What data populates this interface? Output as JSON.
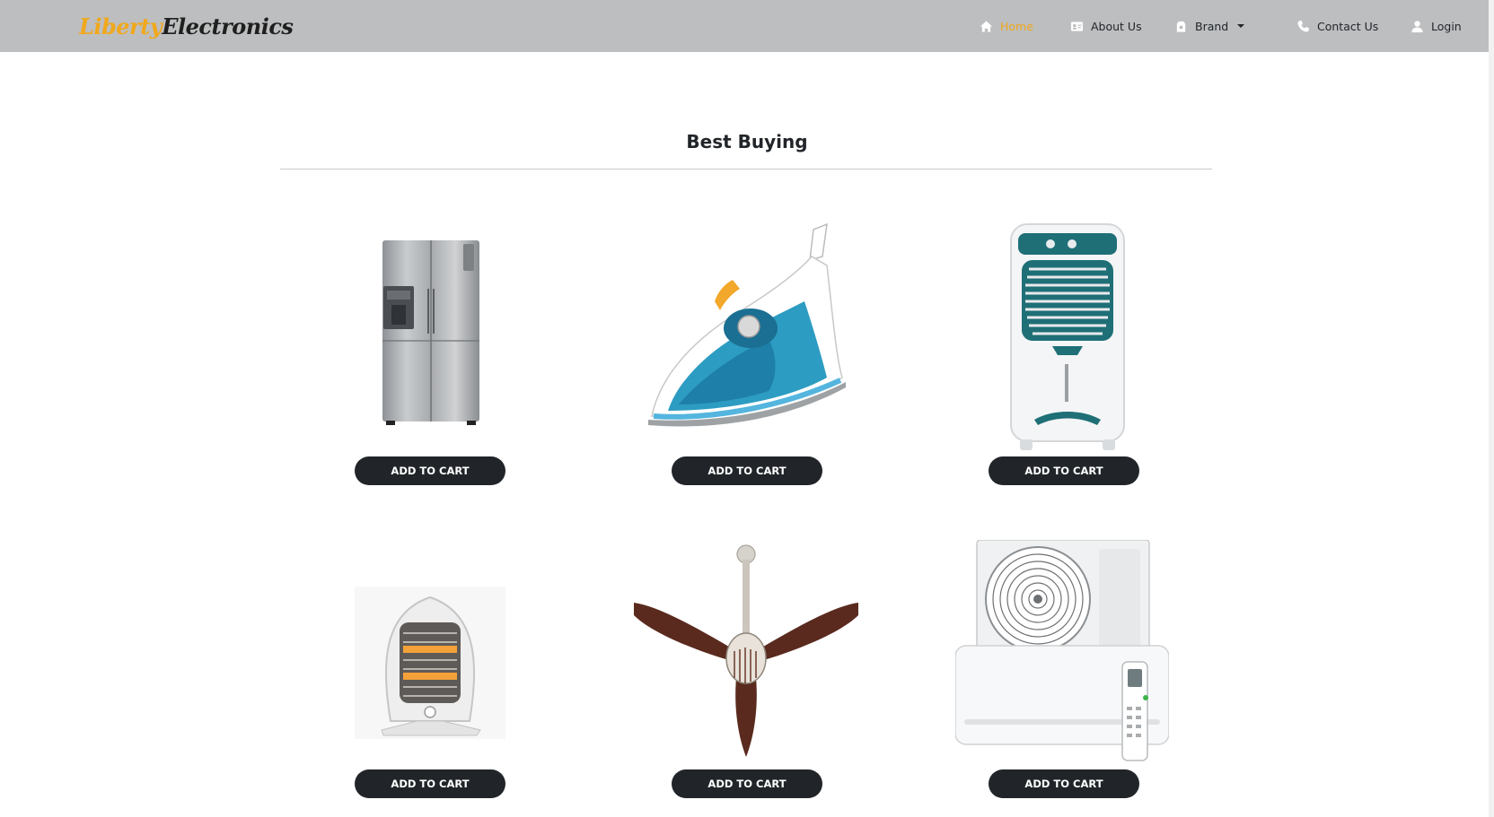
{
  "navbar": {
    "brand_part1": "Liberty",
    "brand_part2": "Electronics",
    "items": [
      {
        "label": "Home",
        "icon": "home-icon",
        "active": true
      },
      {
        "label": "About Us",
        "icon": "id-card-icon",
        "active": false
      },
      {
        "label": "Brand",
        "icon": "tag-icon",
        "active": false,
        "dropdown": true
      },
      {
        "label": "Contact Us",
        "icon": "phone-icon",
        "active": false
      },
      {
        "label": "Login",
        "icon": "user-icon",
        "active": false
      }
    ]
  },
  "section": {
    "title": "Best Buying"
  },
  "products": [
    {
      "image": "refrigerator-image",
      "button_label": "ADD TO CART"
    },
    {
      "image": "steam-iron-image",
      "button_label": "ADD TO CART"
    },
    {
      "image": "air-cooler-image",
      "button_label": "ADD TO CART"
    },
    {
      "image": "room-heater-image",
      "button_label": "ADD TO CART"
    },
    {
      "image": "ceiling-fan-image",
      "button_label": "ADD TO CART"
    },
    {
      "image": "air-conditioner-image",
      "button_label": "ADD TO CART"
    }
  ],
  "colors": {
    "navbar_bg": "#bdbebf",
    "accent": "#f0a81c",
    "button_bg": "#212529",
    "button_text": "#ffffff"
  }
}
